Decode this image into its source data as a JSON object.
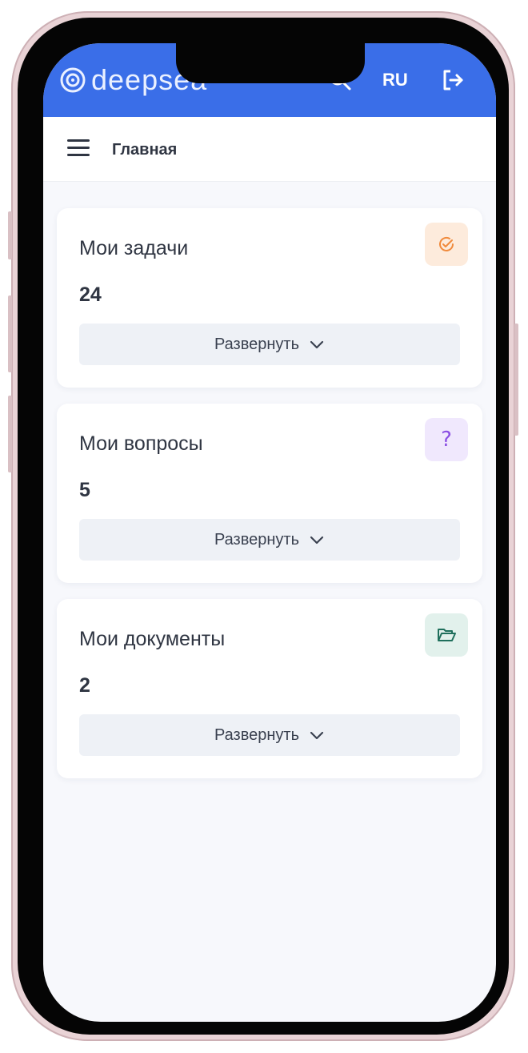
{
  "header": {
    "logo_text": "deepsea",
    "language": "RU",
    "search_icon": "search-icon",
    "logout_icon": "logout-icon"
  },
  "subheader": {
    "menu_icon": "hamburger-menu-icon",
    "title": "Главная"
  },
  "cards": [
    {
      "title": "Мои задачи",
      "count": "24",
      "expand_label": "Развернуть",
      "icon": "check-circle-icon",
      "icon_color": "#f08a3c",
      "icon_bg": "#fdebdc"
    },
    {
      "title": "Мои вопросы",
      "count": "5",
      "expand_label": "Развернуть",
      "icon": "question-icon",
      "icon_color": "#8b4fe3",
      "icon_bg": "#f0e8fd"
    },
    {
      "title": "Мои документы",
      "count": "2",
      "expand_label": "Развернуть",
      "icon": "folder-open-icon",
      "icon_color": "#1f6f5c",
      "icon_bg": "#e2f1ec"
    }
  ],
  "colors": {
    "brand": "#3a6ee8",
    "text": "#2f3542",
    "button_bg": "#eef1f6"
  }
}
